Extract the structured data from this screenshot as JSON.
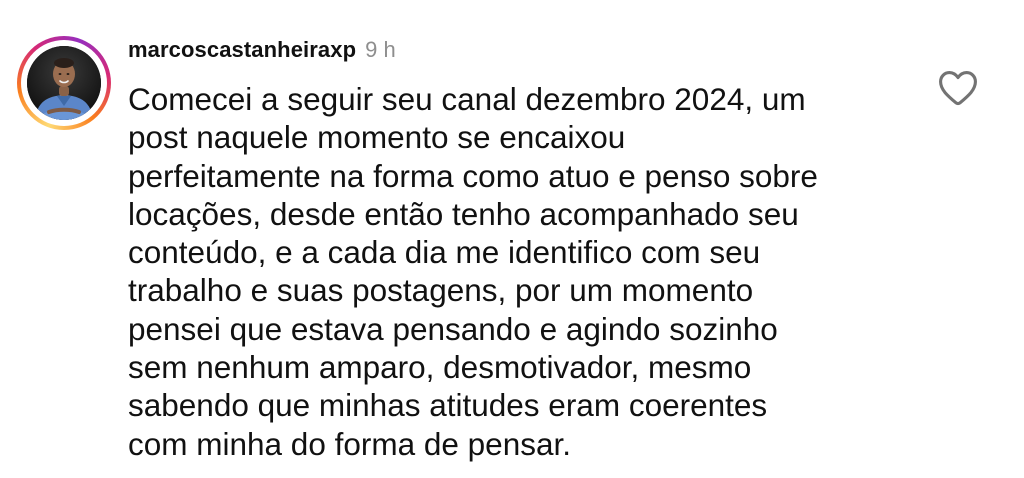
{
  "comment": {
    "username": "marcoscastanheiraxp",
    "timestamp": "9 h",
    "lines": [
      "Comecei a seguir seu canal dezembro 2024, um",
      "post naquele momento se encaixou",
      "perfeitamente na forma como atuo e penso sobre",
      "locações, desde então tenho acompanhado seu",
      "conteúdo, e a cada dia me identifico com seu",
      "trabalho e suas postagens, por um momento",
      "pensei que estava pensando e agindo sozinho",
      "sem nenhum amparo, desmotivador, mesmo",
      "sabendo que minhas atitudes eram coerentes",
      "com minha do forma de pensar."
    ],
    "avatar_icon": "profile-photo",
    "like_icon": "heart-outline-icon"
  },
  "colors": {
    "text": "#111111",
    "timestamp": "#8e8e8e",
    "story_ring": [
      "#feda75",
      "#fa7e1e",
      "#d62976",
      "#962fbf"
    ]
  }
}
